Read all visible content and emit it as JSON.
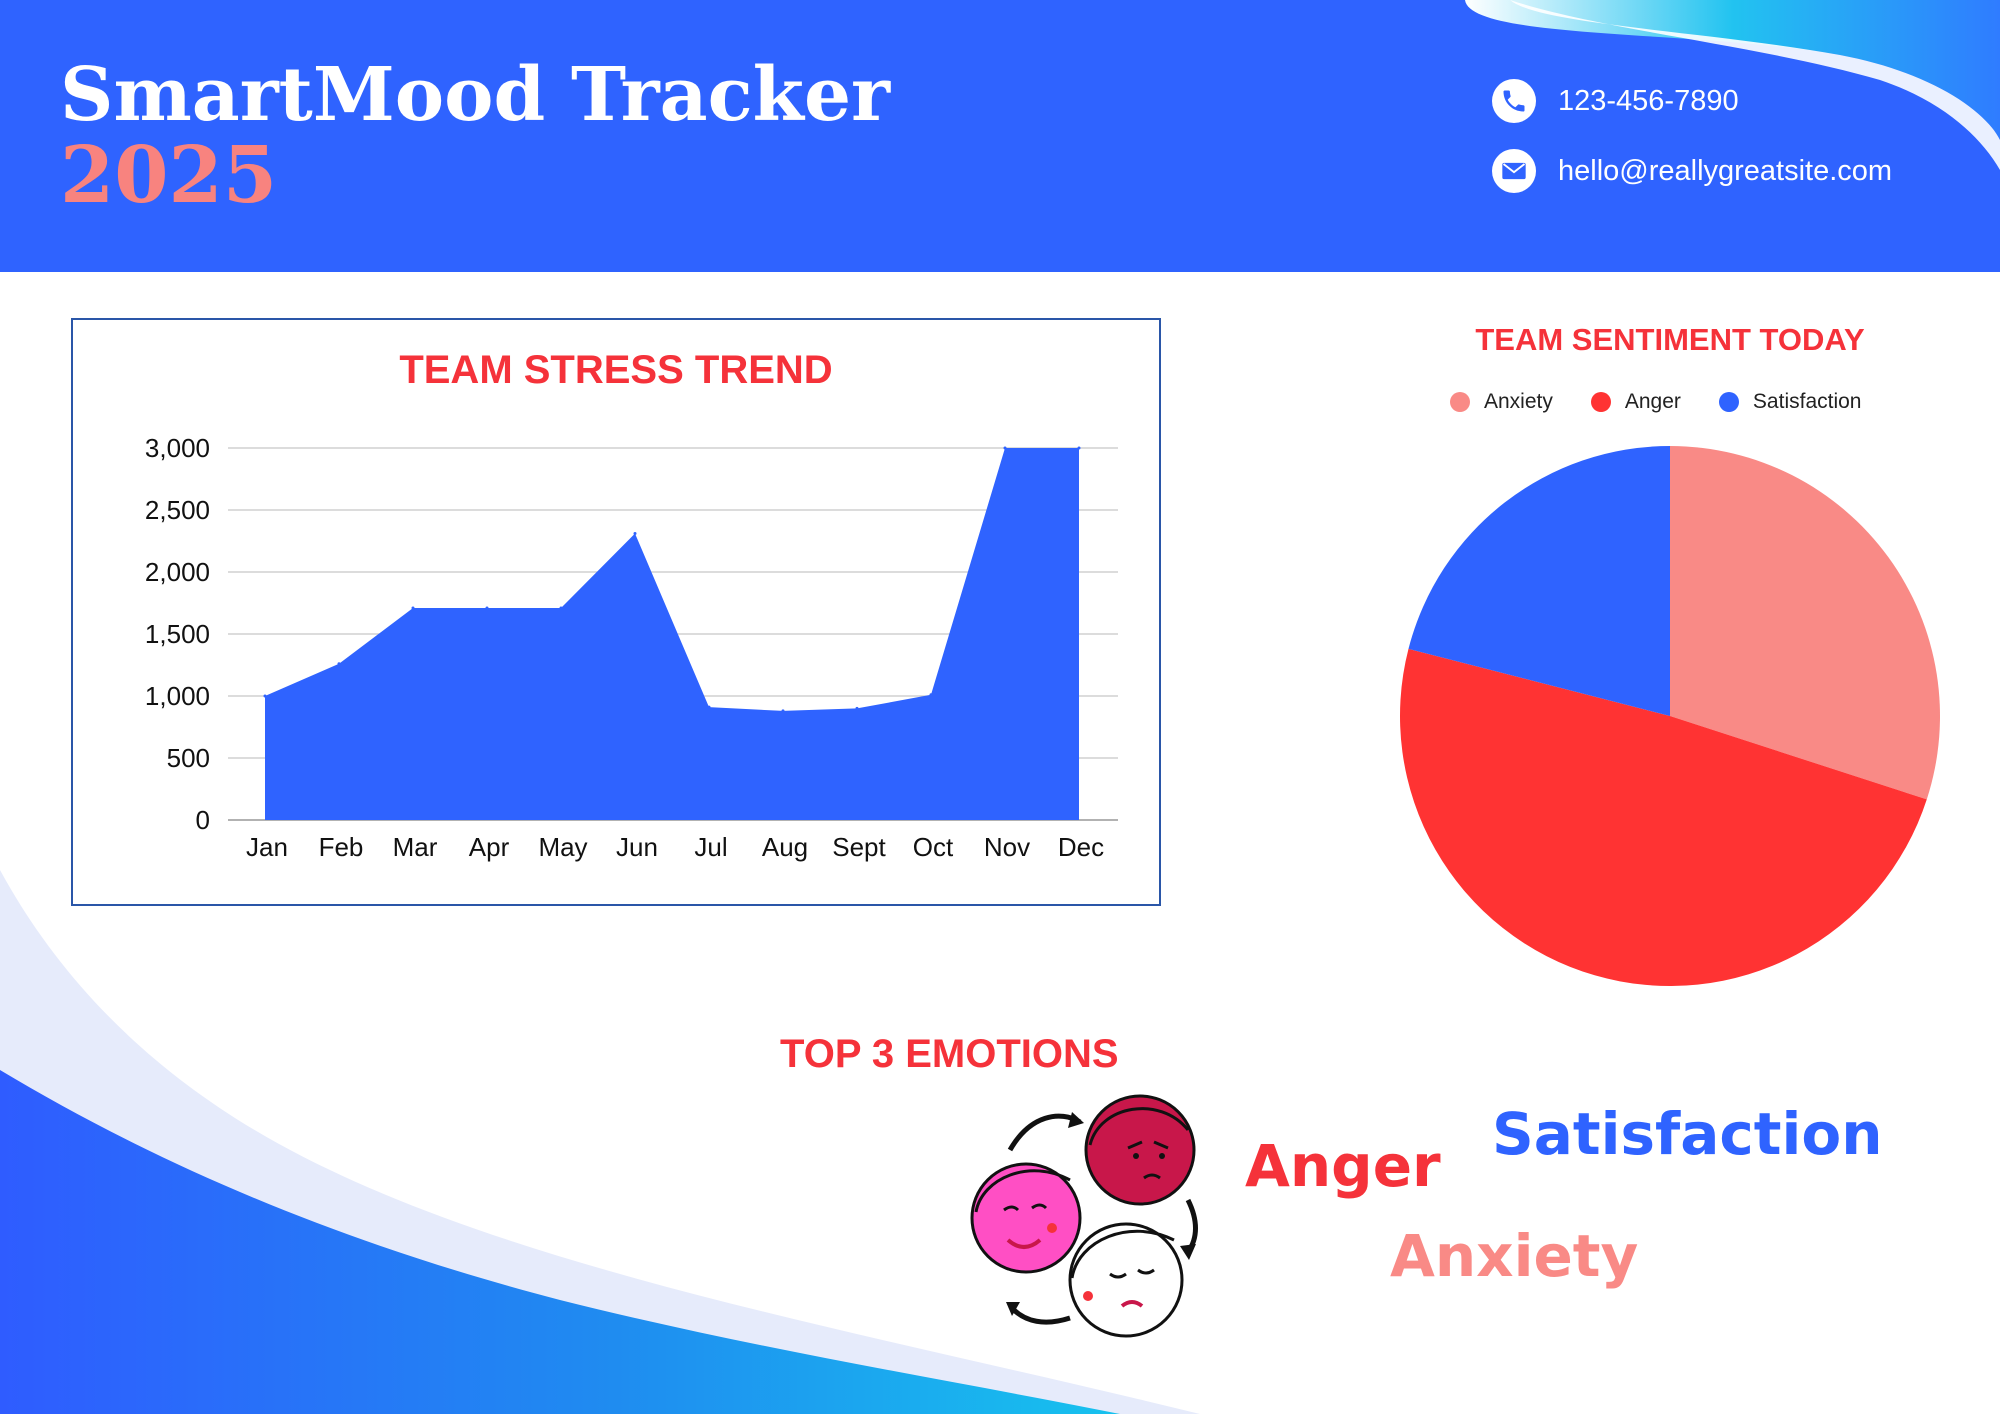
{
  "header": {
    "title": "SmartMood Tracker",
    "year": "2025",
    "phone": "123-456-7890",
    "email": "hello@reallygreatsite.com"
  },
  "colors": {
    "primary_blue": "#2f63ff",
    "accent_red": "#f5323a",
    "accent_pink": "#f8837f",
    "anxiety": "#f98a86",
    "anger": "#ff3333",
    "satisfaction": "#2f63ff"
  },
  "icons": {
    "phone": "phone-icon",
    "email": "envelope-icon"
  },
  "emotions": {
    "title": "TOP 3 EMOTIONS",
    "words": [
      "Anger",
      "Satisfaction",
      "Anxiety"
    ]
  },
  "chart_data": [
    {
      "type": "area",
      "title": "TEAM STRESS TREND",
      "categories": [
        "Jan",
        "Feb",
        "Mar",
        "Apr",
        "May",
        "Jun",
        "Jul",
        "Aug",
        "Sept",
        "Oct",
        "Nov",
        "Dec"
      ],
      "values": [
        1000,
        1260,
        1710,
        1710,
        1710,
        2310,
        910,
        880,
        900,
        1010,
        3000,
        3000
      ],
      "ylim": [
        0,
        3000
      ],
      "yticks": [
        "0",
        "500",
        "1,000",
        "1,500",
        "2,000",
        "2,500",
        "3,000"
      ],
      "grid": true,
      "color": "#2f63ff"
    },
    {
      "type": "pie",
      "title": "TEAM SENTIMENT TODAY",
      "legend_position": "top",
      "series": [
        {
          "name": "Anxiety",
          "value": 30,
          "color": "#f98a86"
        },
        {
          "name": "Anger",
          "value": 49,
          "color": "#ff3333"
        },
        {
          "name": "Satisfaction",
          "value": 21,
          "color": "#2f63ff"
        }
      ]
    }
  ]
}
